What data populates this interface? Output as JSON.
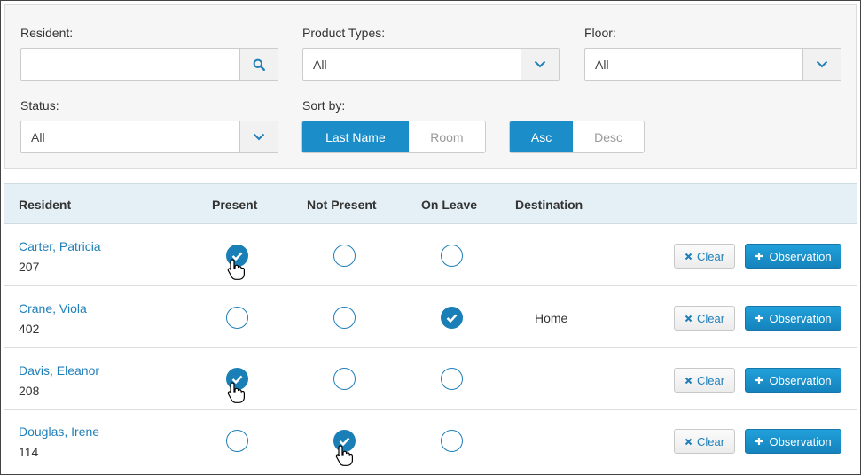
{
  "filters": {
    "resident_label": "Resident:",
    "resident_value": "",
    "product_types_label": "Product Types:",
    "product_types_value": "All",
    "floor_label": "Floor:",
    "floor_value": "All",
    "status_label": "Status:",
    "status_value": "All",
    "sort_by_label": "Sort by:",
    "sort_options": [
      "Last Name",
      "Room"
    ],
    "sort_selected": "Last Name",
    "order_options": [
      "Asc",
      "Desc"
    ],
    "order_selected": "Asc"
  },
  "table": {
    "headers": [
      "Resident",
      "Present",
      "Not Present",
      "On Leave",
      "Destination"
    ],
    "clear_label": "Clear",
    "observation_label": "Observation",
    "rows": [
      {
        "name": "Carter, Patricia",
        "room": "207",
        "status": "present",
        "destination": ""
      },
      {
        "name": "Crane, Viola",
        "room": "402",
        "status": "on_leave",
        "destination": "Home"
      },
      {
        "name": "Davis, Eleanor",
        "room": "208",
        "status": "present",
        "destination": ""
      },
      {
        "name": "Douglas, Irene",
        "room": "114",
        "status": "not_present",
        "destination": ""
      }
    ]
  },
  "colors": {
    "accent": "#1b8ec9",
    "link": "#1f7fb8",
    "header_bg": "#e4f0f6"
  }
}
